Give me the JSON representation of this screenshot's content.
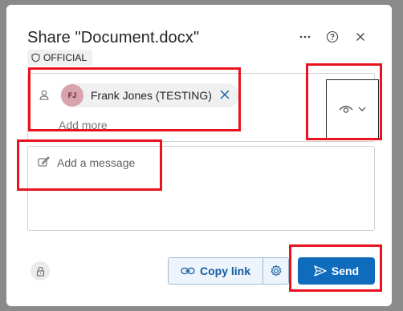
{
  "dialog": {
    "title": "Share \"Document.docx\"",
    "badge_label": "OFFICIAL",
    "more_icon": "more-horizontal-icon",
    "help_icon": "help-circle-icon",
    "close_icon": "close-icon"
  },
  "recipients": {
    "chips": [
      {
        "initials": "FJ",
        "name": "Frank Jones (TESTING)"
      }
    ],
    "add_more_placeholder": "Add more",
    "permission_icon": "eye-icon"
  },
  "message": {
    "placeholder": "Add a message"
  },
  "footer": {
    "copy_link_label": "Copy link",
    "send_label": "Send",
    "lock_icon": "lock-icon",
    "settings_icon": "gear-icon"
  },
  "colors": {
    "accent": "#0f6cbd",
    "highlight": "#e8131f",
    "avatar_bg": "#d9a3ad"
  }
}
